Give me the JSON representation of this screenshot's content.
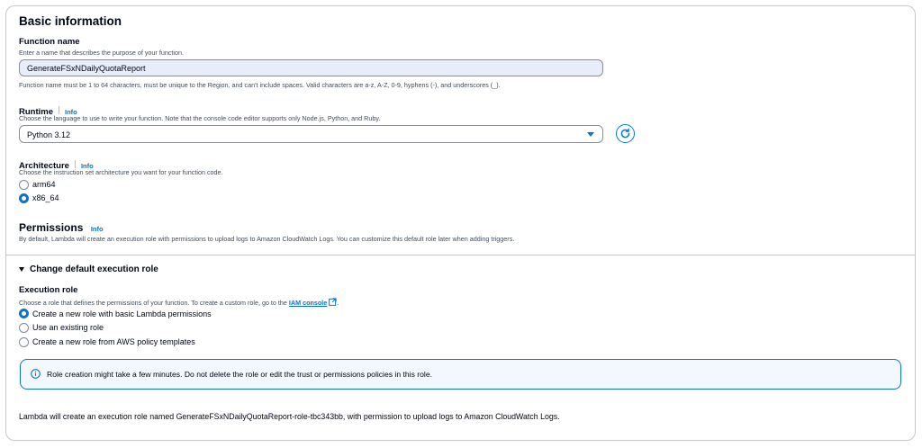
{
  "section": {
    "title": "Basic information"
  },
  "function_name": {
    "label": "Function name",
    "description": "Enter a name that describes the purpose of your function.",
    "value": "GenerateFSxNDailyQuotaReport",
    "constraint": "Function name must be 1 to 64 characters, must be unique to the Region, and can't include spaces. Valid characters are a-z, A-Z, 0-9, hyphens (-), and underscores (_)."
  },
  "runtime": {
    "label": "Runtime",
    "info": "Info",
    "description": "Choose the language to use to write your function. Note that the console code editor supports only Node.js, Python, and Ruby.",
    "selected": "Python 3.12",
    "refresh_icon": "refresh-icon"
  },
  "architecture": {
    "label": "Architecture",
    "info": "Info",
    "description": "Choose the instruction set architecture you want for your function code.",
    "options": [
      {
        "label": "arm64",
        "selected": false
      },
      {
        "label": "x86_64",
        "selected": true
      }
    ]
  },
  "permissions": {
    "title": "Permissions",
    "info": "Info",
    "description": "By default, Lambda will create an execution role with permissions to upload logs to Amazon CloudWatch Logs. You can customize this default role later when adding triggers."
  },
  "execution_role": {
    "expander_label": "Change default execution role",
    "label": "Execution role",
    "description": "Choose a role that defines the permissions of your function. To create a custom role, go to the",
    "link_text": "IAM console",
    "link_suffix": ".",
    "options": [
      {
        "label": "Create a new role with basic Lambda permissions",
        "selected": true
      },
      {
        "label": "Use an existing role",
        "selected": false
      },
      {
        "label": "Create a new role from AWS policy templates",
        "selected": false
      }
    ]
  },
  "alert": {
    "icon": "info-icon",
    "text": "Role creation might take a few minutes. Do not delete the role or edit the trust or permissions policies in this role."
  },
  "footer_note": "Lambda will create an execution role named GenerateFSxNDailyQuotaReport-role-tbc343bb, with permission to upload logs to Amazon CloudWatch Logs.",
  "colors": {
    "accent": "#0972d3",
    "border": "#c6c6cd",
    "text": "#000716",
    "muted": "#414d5c"
  }
}
